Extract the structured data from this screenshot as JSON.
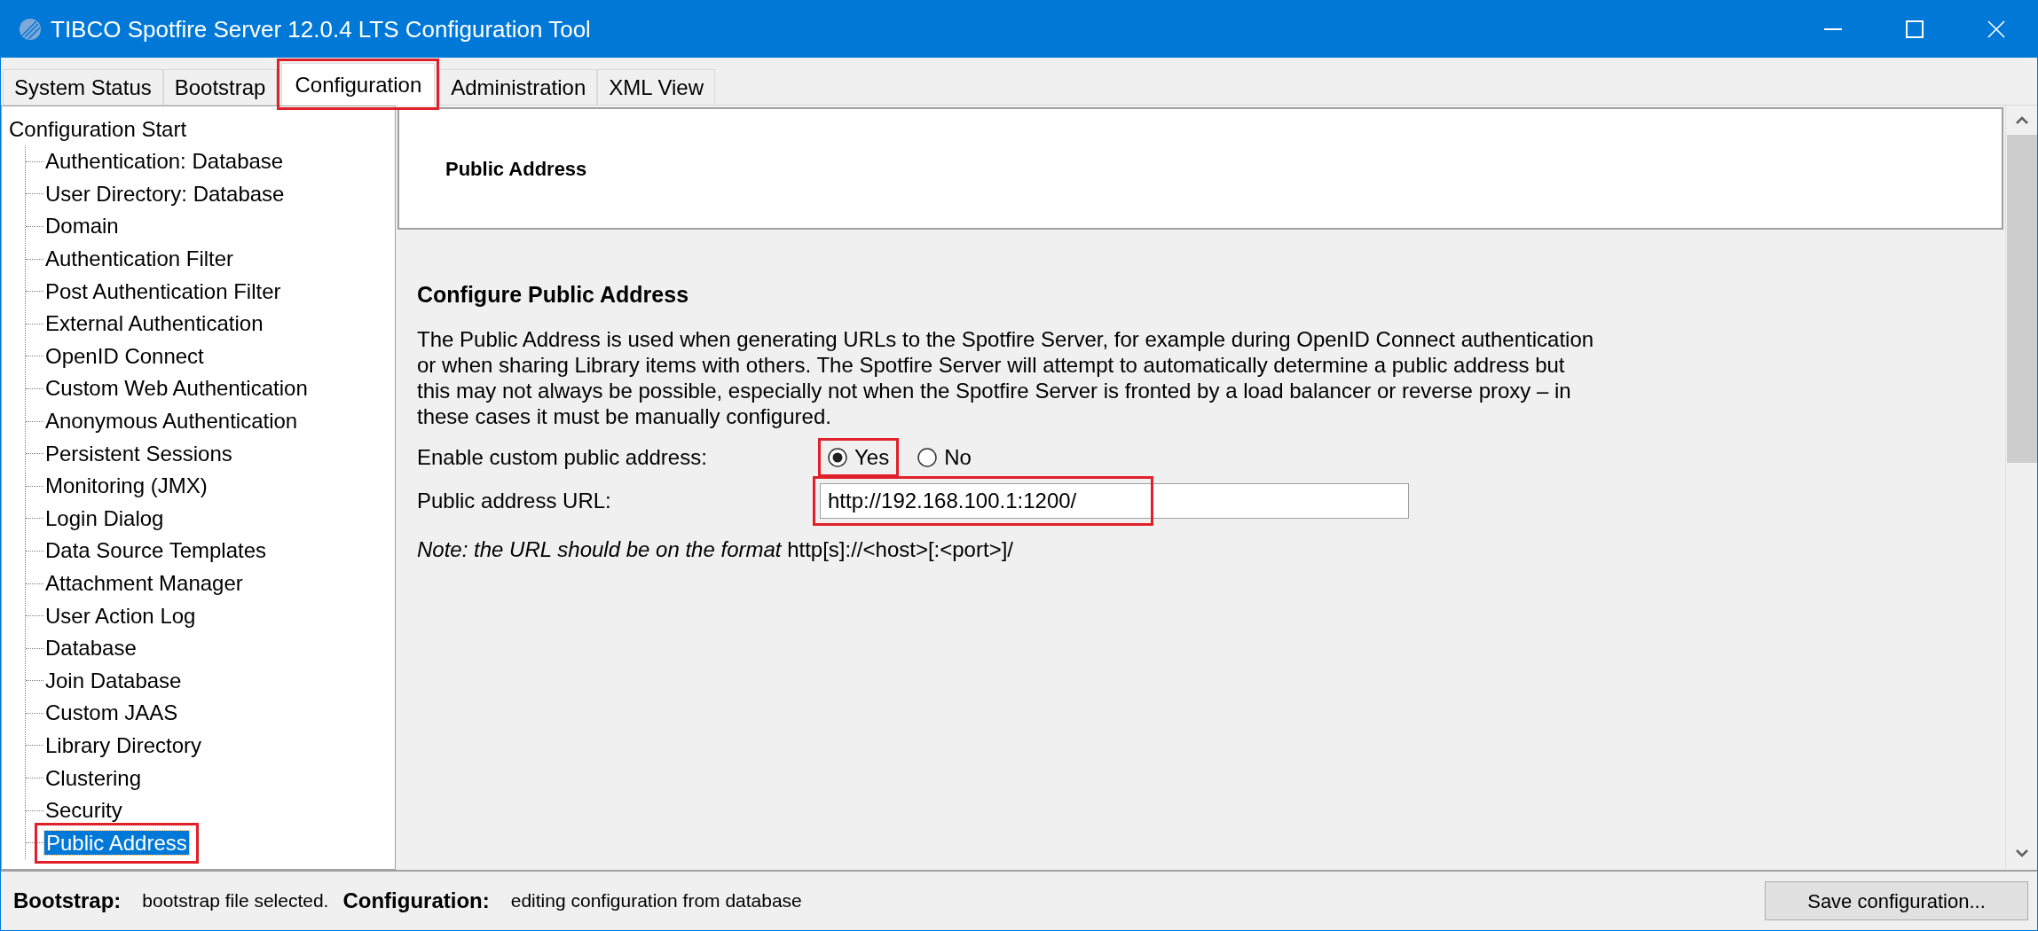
{
  "window": {
    "title": "TIBCO Spotfire Server 12.0.4 LTS Configuration Tool"
  },
  "tabs": [
    {
      "label": "System Status",
      "selected": false,
      "highlighted": false
    },
    {
      "label": "Bootstrap",
      "selected": false,
      "highlighted": false
    },
    {
      "label": "Configuration",
      "selected": true,
      "highlighted": true
    },
    {
      "label": "Administration",
      "selected": false,
      "highlighted": false
    },
    {
      "label": "XML View",
      "selected": false,
      "highlighted": false
    }
  ],
  "tree": {
    "label": "Configuration Start",
    "children": [
      {
        "label": "Authentication: Database",
        "selected": false,
        "highlighted": false
      },
      {
        "label": "User Directory: Database",
        "selected": false,
        "highlighted": false
      },
      {
        "label": "Domain",
        "selected": false,
        "highlighted": false
      },
      {
        "label": "Authentication Filter",
        "selected": false,
        "highlighted": false
      },
      {
        "label": "Post Authentication Filter",
        "selected": false,
        "highlighted": false
      },
      {
        "label": "External Authentication",
        "selected": false,
        "highlighted": false
      },
      {
        "label": "OpenID Connect",
        "selected": false,
        "highlighted": false
      },
      {
        "label": "Custom Web Authentication",
        "selected": false,
        "highlighted": false
      },
      {
        "label": "Anonymous Authentication",
        "selected": false,
        "highlighted": false
      },
      {
        "label": "Persistent Sessions",
        "selected": false,
        "highlighted": false
      },
      {
        "label": "Monitoring (JMX)",
        "selected": false,
        "highlighted": false
      },
      {
        "label": "Login Dialog",
        "selected": false,
        "highlighted": false
      },
      {
        "label": "Data Source Templates",
        "selected": false,
        "highlighted": false
      },
      {
        "label": "Attachment Manager",
        "selected": false,
        "highlighted": false
      },
      {
        "label": "User Action Log",
        "selected": false,
        "highlighted": false
      },
      {
        "label": "Database",
        "selected": false,
        "highlighted": false
      },
      {
        "label": "Join Database",
        "selected": false,
        "highlighted": false
      },
      {
        "label": "Custom JAAS",
        "selected": false,
        "highlighted": false
      },
      {
        "label": "Library Directory",
        "selected": false,
        "highlighted": false
      },
      {
        "label": "Clustering",
        "selected": false,
        "highlighted": false
      },
      {
        "label": "Security",
        "selected": false,
        "highlighted": false
      },
      {
        "label": "Public Address",
        "selected": true,
        "highlighted": true
      }
    ]
  },
  "panel": {
    "header": "Public Address",
    "heading": "Configure Public Address",
    "description": "The Public Address is used when generating URLs to the Spotfire Server, for example during OpenID Connect authentication or when sharing Library items with others. The Spotfire Server will attempt to automatically determine a public address but this may not always be possible, especially not when the Spotfire Server is fronted by a load balancer or reverse proxy – in these cases it must be manually configured.",
    "enable_label": "Enable custom public address:",
    "enable_options": [
      {
        "label": "Yes",
        "selected": true,
        "highlighted": true
      },
      {
        "label": "No",
        "selected": false,
        "highlighted": false
      }
    ],
    "url_label": "Public address URL:",
    "url_field": {
      "value": "http://192.168.100.1:1200/",
      "highlighted": true
    },
    "note": "*Note: the URL should be on the format* http[s]://<host>[:<port>]/"
  },
  "status_bar": {
    "bootstrap_label": "Bootstrap:",
    "bootstrap_text": "bootstrap file selected.",
    "configuration_label": "Configuration:",
    "configuration_text": "editing configuration from database",
    "save_button": "Save configuration..."
  }
}
